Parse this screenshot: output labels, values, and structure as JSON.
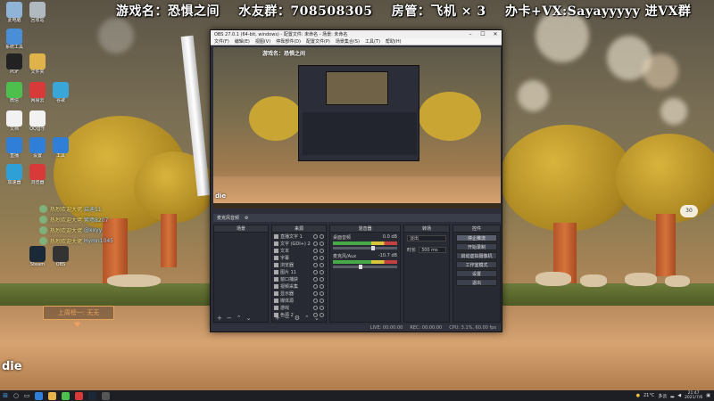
{
  "overlay": {
    "game_label": "游戏名：恐惧之间",
    "fan_group": "水友群：708508305",
    "room_admin": "房管：飞机 × 3",
    "promo": "办卡+VX:Sayayyyyy 进VX群",
    "die_text": "die",
    "goal_text": "上周榜一: 无无",
    "side_number": "30"
  },
  "desktop_icons": [
    {
      "label": "此电脑",
      "color": "#8fb4d8"
    },
    {
      "label": "回收站",
      "color": "#b0b8c0"
    },
    {
      "label": "系统工具",
      "color": "#4a8ed8"
    },
    {
      "label": "PDF",
      "color": "#222222"
    },
    {
      "label": "文件夹",
      "color": "#e0b24a"
    },
    {
      "label": "微信",
      "color": "#4cbf4c"
    },
    {
      "label": "网易云",
      "color": "#d83a3a"
    },
    {
      "label": "谷歌",
      "color": "#3aa6d8"
    },
    {
      "label": "文档",
      "color": "#f2f2f2"
    },
    {
      "label": "QQ音乐",
      "color": "#f2f2f2"
    },
    {
      "label": "直播",
      "color": "#2f7fd8"
    },
    {
      "label": "设置",
      "color": "#2f7fd8"
    },
    {
      "label": "工具",
      "color": "#2f7fd8"
    },
    {
      "label": "浏览器",
      "color": "#d83a3a"
    },
    {
      "label": "加速器",
      "color": "#2f9fd8"
    },
    {
      "label": "Steam",
      "color": "#1b2838"
    },
    {
      "label": "OBS",
      "color": "#333333"
    }
  ],
  "chat": [
    {
      "who": "热烈欢迎大佬",
      "msg": "启迪11"
    },
    {
      "who": "热烈欢迎大佬",
      "msg": "紫墙8207"
    },
    {
      "who": "热烈欢迎大佬",
      "msg": "@xxyy"
    },
    {
      "who": "热烈欢迎大佬",
      "msg": "Hymn1045"
    }
  ],
  "obs": {
    "title": "OBS 27.0.1 (64-bit, windows) - 配置文件: 未命名 - 场景: 未命名",
    "menu": [
      "文件(F)",
      "编辑(E)",
      "视图(V)",
      "停靠部件(D)",
      "配置文件(P)",
      "场景集合(S)",
      "工具(T)",
      "帮助(H)"
    ],
    "toolbar_label": "麦克风音频",
    "scenes_header": "场景",
    "sources_header": "来源",
    "mixer_header": "混音器",
    "transitions_header": "转场",
    "controls_header": "控件",
    "sources": [
      {
        "name": "直播文字 1"
      },
      {
        "name": "文字 (GDI+) 2"
      },
      {
        "name": "文本"
      },
      {
        "name": "字幕"
      },
      {
        "name": "浏览器"
      },
      {
        "name": "图片 11"
      },
      {
        "name": "窗口捕获"
      },
      {
        "name": "视频采集"
      },
      {
        "name": "显示器"
      },
      {
        "name": "媒体源"
      },
      {
        "name": "游戏"
      },
      {
        "name": "色源 2"
      }
    ],
    "mixer": [
      {
        "name": "桌面音频",
        "db": "0.0 dB"
      },
      {
        "name": "麦克风/Aux",
        "db": "-10.7 dB"
      }
    ],
    "transition": {
      "type": "淡出",
      "duration_label": "时长",
      "duration": "300 ms"
    },
    "controls": [
      "停止推流",
      "开始录制",
      "启动虚拟摄像机",
      "工作室模式",
      "设置",
      "退出"
    ],
    "status": [
      "LIVE: 00:00:00",
      "REC: 00:00:00",
      "CPU: 3.1%, 60.00 fps"
    ]
  },
  "taskbar": {
    "temp": "21°C",
    "weather": "多云",
    "time": "21:47",
    "date": "2021/7/6"
  }
}
